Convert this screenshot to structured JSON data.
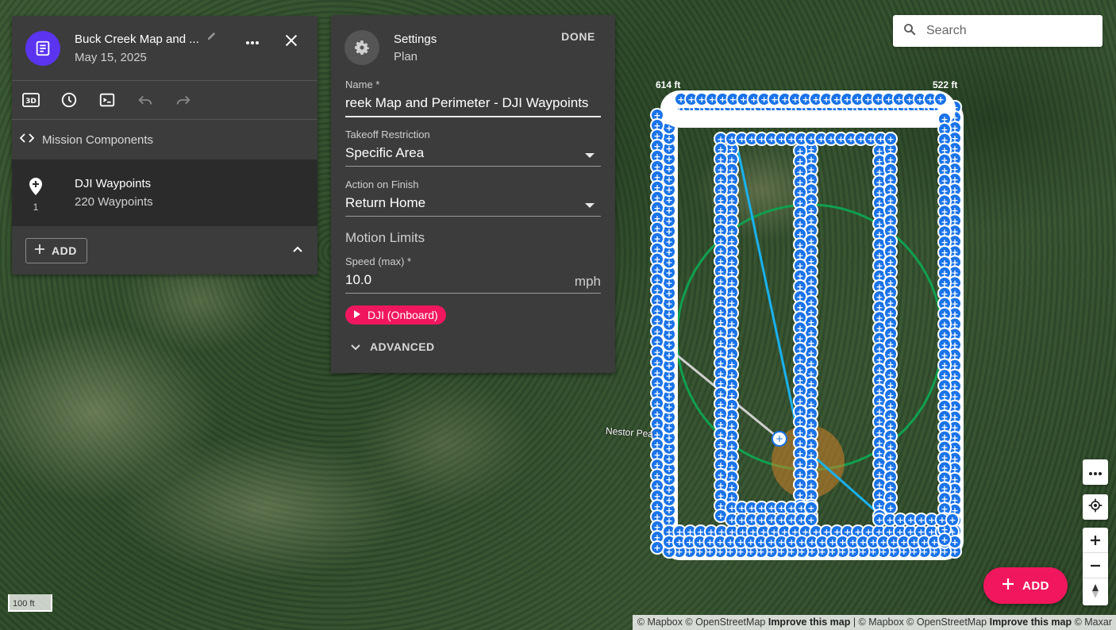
{
  "mission": {
    "title": "Buck Creek Map and ...",
    "date": "May 15, 2025",
    "components_label": "Mission Components",
    "component": {
      "title": "DJI Waypoints",
      "subtitle": "220 Waypoints",
      "index": "1"
    },
    "add_label": "ADD"
  },
  "settings": {
    "title": "Settings",
    "subtitle": "Plan",
    "done_label": "DONE",
    "name_label": "Name *",
    "name_value": "reek Map and Perimeter - DJI Waypoints",
    "takeoff_label": "Takeoff Restriction",
    "takeoff_value": "Specific Area",
    "finish_label": "Action on Finish",
    "finish_value": "Return Home",
    "motion_title": "Motion Limits",
    "speed_label": "Speed (max) *",
    "speed_value": "10.0",
    "speed_unit": "mph",
    "chip_label": "DJI (Onboard)",
    "advanced_label": "ADVANCED"
  },
  "search": {
    "placeholder": "Search"
  },
  "map": {
    "place_label": "Nestor Pea",
    "scale_label": "100 ft",
    "alt_left": "614 ft",
    "alt_right": "522 ft",
    "fab_label": "ADD",
    "attribution": {
      "a1": "© Mapbox © OpenStreetMap",
      "a2": "Improve this map",
      "a3": "| © Mapbox © OpenStreetMap",
      "a4": "Improve this map",
      "a5": "© Maxar"
    }
  },
  "colors": {
    "accent": "#f1175e",
    "doc_avatar": "#5b34f0",
    "waypoint": "#1a73e8",
    "geofence": "#10a050"
  }
}
